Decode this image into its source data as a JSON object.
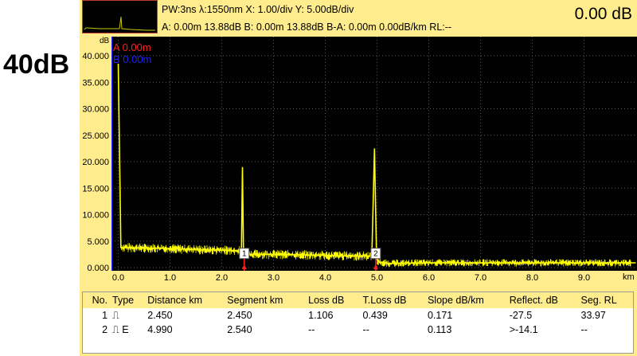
{
  "side_label": "40dB",
  "header": {
    "info_line1": "PW:3ns λ:1550nm  X: 1.00/div Y: 5.00dB/div",
    "info_line2": "A: 0.00m 13.88dB B: 0.00m 13.88dB B-A: 0.00m 0.00dB/km RL:--",
    "readout": "0.00 dB"
  },
  "plot": {
    "y_unit": "dB",
    "x_unit": "km",
    "cursor_a": "A 0.00m",
    "cursor_b": "B 0.00m",
    "y_ticks": [
      "0.000",
      "5.000",
      "10.000",
      "15.000",
      "20.000",
      "25.000",
      "30.000",
      "35.000",
      "40.000"
    ],
    "x_ticks": [
      "0.0",
      "1.0",
      "2.0",
      "3.0",
      "4.0",
      "5.0",
      "6.0",
      "7.0",
      "8.0",
      "9.0"
    ],
    "event_markers": [
      "1",
      "2"
    ],
    "colors": {
      "background": "#000000",
      "trace": "#ffff00",
      "grid": "#5a5a5a",
      "cursor_a": "#ff2020",
      "cursor_b": "#2020ff"
    }
  },
  "chart_data": {
    "type": "line",
    "xlabel": "km",
    "ylabel": "dB",
    "xlim": [
      0,
      10
    ],
    "ylim": [
      0,
      40
    ],
    "grid": true,
    "series": [
      {
        "x": [
          0.0,
          0.05,
          0.5,
          1.0,
          1.5,
          2.0,
          2.38,
          2.4,
          2.42,
          2.46,
          2.5,
          3.0,
          3.5,
          4.0,
          4.5,
          4.9,
          4.95,
          4.99,
          5.0,
          5.02,
          5.1,
          5.2,
          6.0,
          7.0,
          8.0,
          9.0,
          10.0
        ],
        "y": [
          38.5,
          3.8,
          3.7,
          3.6,
          3.4,
          3.3,
          3.2,
          19.0,
          3.0,
          2.6,
          2.5,
          2.5,
          2.4,
          2.3,
          2.2,
          2.2,
          22.5,
          2.0,
          1.5,
          1.2,
          0.9,
          0.8,
          0.9,
          0.9,
          0.9,
          0.9,
          0.9
        ]
      }
    ],
    "events": [
      {
        "label": "1",
        "x": 2.45
      },
      {
        "label": "2",
        "x": 4.99
      }
    ]
  },
  "table": {
    "headers": [
      "No.",
      "Type",
      "Distance km",
      "Segment km",
      "Loss dB",
      "T.Loss dB",
      "Slope dB/km",
      "Reflect. dB",
      "Seg. RL"
    ],
    "rows": [
      [
        "1",
        "⎍",
        "2.450",
        "2.450",
        "1.106",
        "0.439",
        "0.171",
        "-27.5",
        "33.97"
      ],
      [
        "2",
        "⎍ E",
        "4.990",
        "2.540",
        "--",
        "--",
        "0.113",
        ">-14.1",
        "--"
      ]
    ]
  }
}
